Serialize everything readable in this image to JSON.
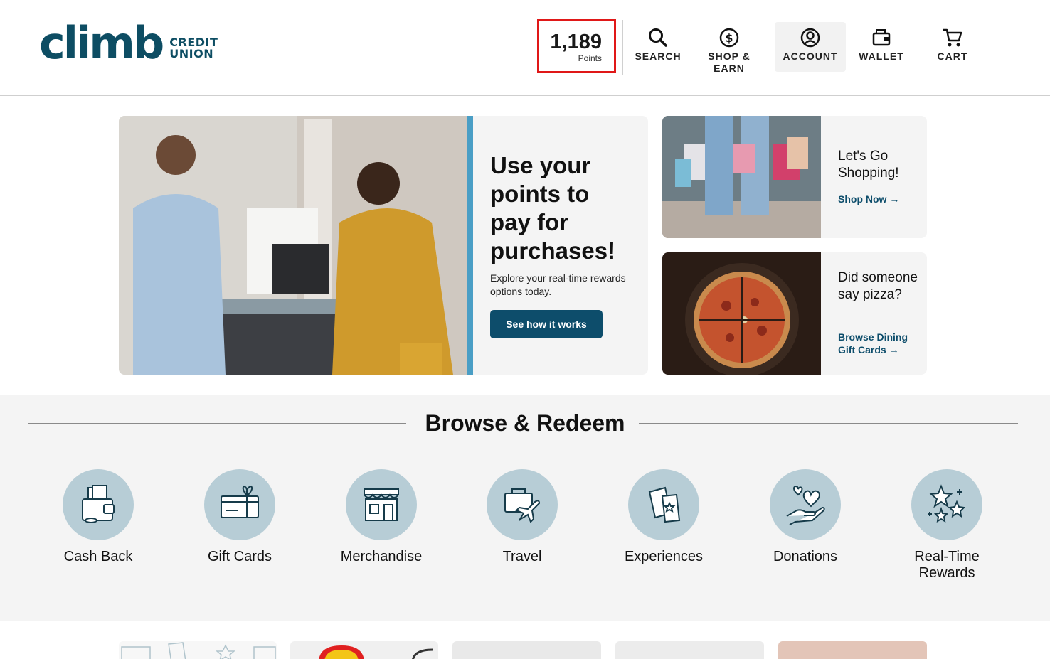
{
  "header": {
    "logo": {
      "word": "climb",
      "sub_line1": "CREDIT",
      "sub_line2": "UNION"
    },
    "points": {
      "value": "1,189",
      "label": "Points"
    },
    "nav": [
      {
        "label": "SEARCH",
        "icon": "search-icon"
      },
      {
        "label": "SHOP &",
        "label2": "EARN",
        "icon": "dollar-circle-icon"
      },
      {
        "label": "ACCOUNT",
        "icon": "user-circle-icon"
      },
      {
        "label": "WALLET",
        "icon": "wallet-icon"
      },
      {
        "label": "CART",
        "icon": "cart-icon"
      }
    ]
  },
  "hero": {
    "title": "Use your points to pay for purchases!",
    "subtitle": "Explore your real-time rewards options today.",
    "button": "See how it works"
  },
  "promos": [
    {
      "title": "Let's Go Shopping!",
      "link": "Shop Now →"
    },
    {
      "title": "Did someone say pizza?",
      "link": "Browse Dining Gift Cards →"
    }
  ],
  "browse": {
    "title": "Browse & Redeem",
    "categories": [
      {
        "label": "Cash Back",
        "icon": "cash-back-icon"
      },
      {
        "label": "Gift Cards",
        "icon": "gift-card-icon"
      },
      {
        "label": "Merchandise",
        "icon": "store-icon"
      },
      {
        "label": "Travel",
        "icon": "travel-icon"
      },
      {
        "label": "Experiences",
        "icon": "tickets-icon"
      },
      {
        "label": "Donations",
        "icon": "donation-hearts-icon"
      },
      {
        "label": "Real-Time",
        "label2": "Rewards",
        "icon": "stars-icon"
      }
    ]
  },
  "colors": {
    "brand": "#0d4d63",
    "accent": "#4a9ec5",
    "button": "#0d4d6b",
    "highlight_border": "#e01818",
    "category_circle": "#b7cdd6"
  }
}
